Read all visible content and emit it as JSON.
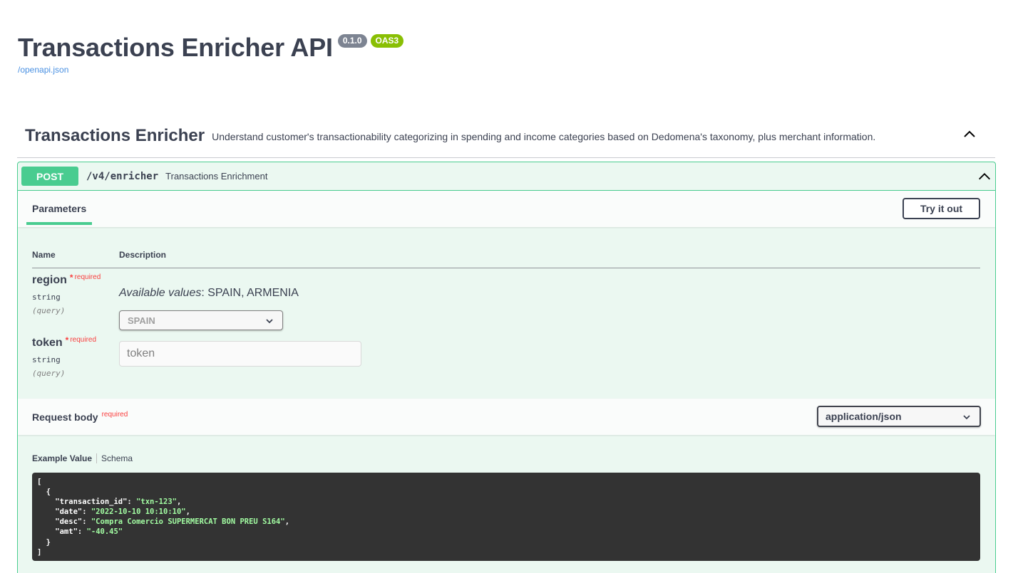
{
  "info": {
    "title": "Transactions Enricher API",
    "version": "0.1.0",
    "oas_badge": "OAS3",
    "spec_link": "/openapi.json"
  },
  "tag": {
    "name": "Transactions Enricher",
    "description": "Understand customer's transactionability categorizing in spending and income categories based on Dedomena's taxonomy, plus merchant information."
  },
  "operation": {
    "method": "POST",
    "path": "/v4/enricher",
    "summary": "Transactions Enrichment",
    "tab_parameters": "Parameters",
    "try_it_out": "Try it out",
    "columns": {
      "name": "Name",
      "description": "Description"
    },
    "params": [
      {
        "name": "region",
        "required_star": "*",
        "required_text": "required",
        "type": "string",
        "in": "(query)",
        "available_label": "Available values",
        "available_values": ": SPAIN, ARMENIA",
        "selected": "SPAIN"
      },
      {
        "name": "token",
        "required_star": "*",
        "required_text": "required",
        "type": "string",
        "in": "(query)",
        "placeholder": "token"
      }
    ],
    "request_body": {
      "title": "Request body",
      "required_text": "required",
      "content_type": "application/json",
      "tab_example": "Example Value",
      "tab_schema": "Schema",
      "example": {
        "l1": "[",
        "l2": "  {",
        "k_id": "    \"transaction_id\": ",
        "v_id": "\"txn-123\"",
        "k_date": "    \"date\": ",
        "v_date": "\"2022-10-10 10:10:10\"",
        "k_desc": "    \"desc\": ",
        "v_desc": "\"Compra Comercio SUPERMERCAT BON PREU S164\"",
        "k_amt": "    \"amt\": ",
        "v_amt": "\"-40.45\"",
        "comma": ",",
        "l8": "  }",
        "l9": "]"
      }
    }
  },
  "colors": {
    "post": "#49cc90",
    "post_bg": "#ebf8f1",
    "required": "#f93e3e",
    "link": "#4990e2",
    "version_badge": "#7d8492",
    "oas_badge": "#89bf04",
    "code_bg": "#333333",
    "code_string": "#a2fca2"
  },
  "icons": {
    "tag_toggle": "chevron-up-icon",
    "op_toggle": "chevron-up-icon",
    "select_arrow": "chevron-down-icon"
  }
}
